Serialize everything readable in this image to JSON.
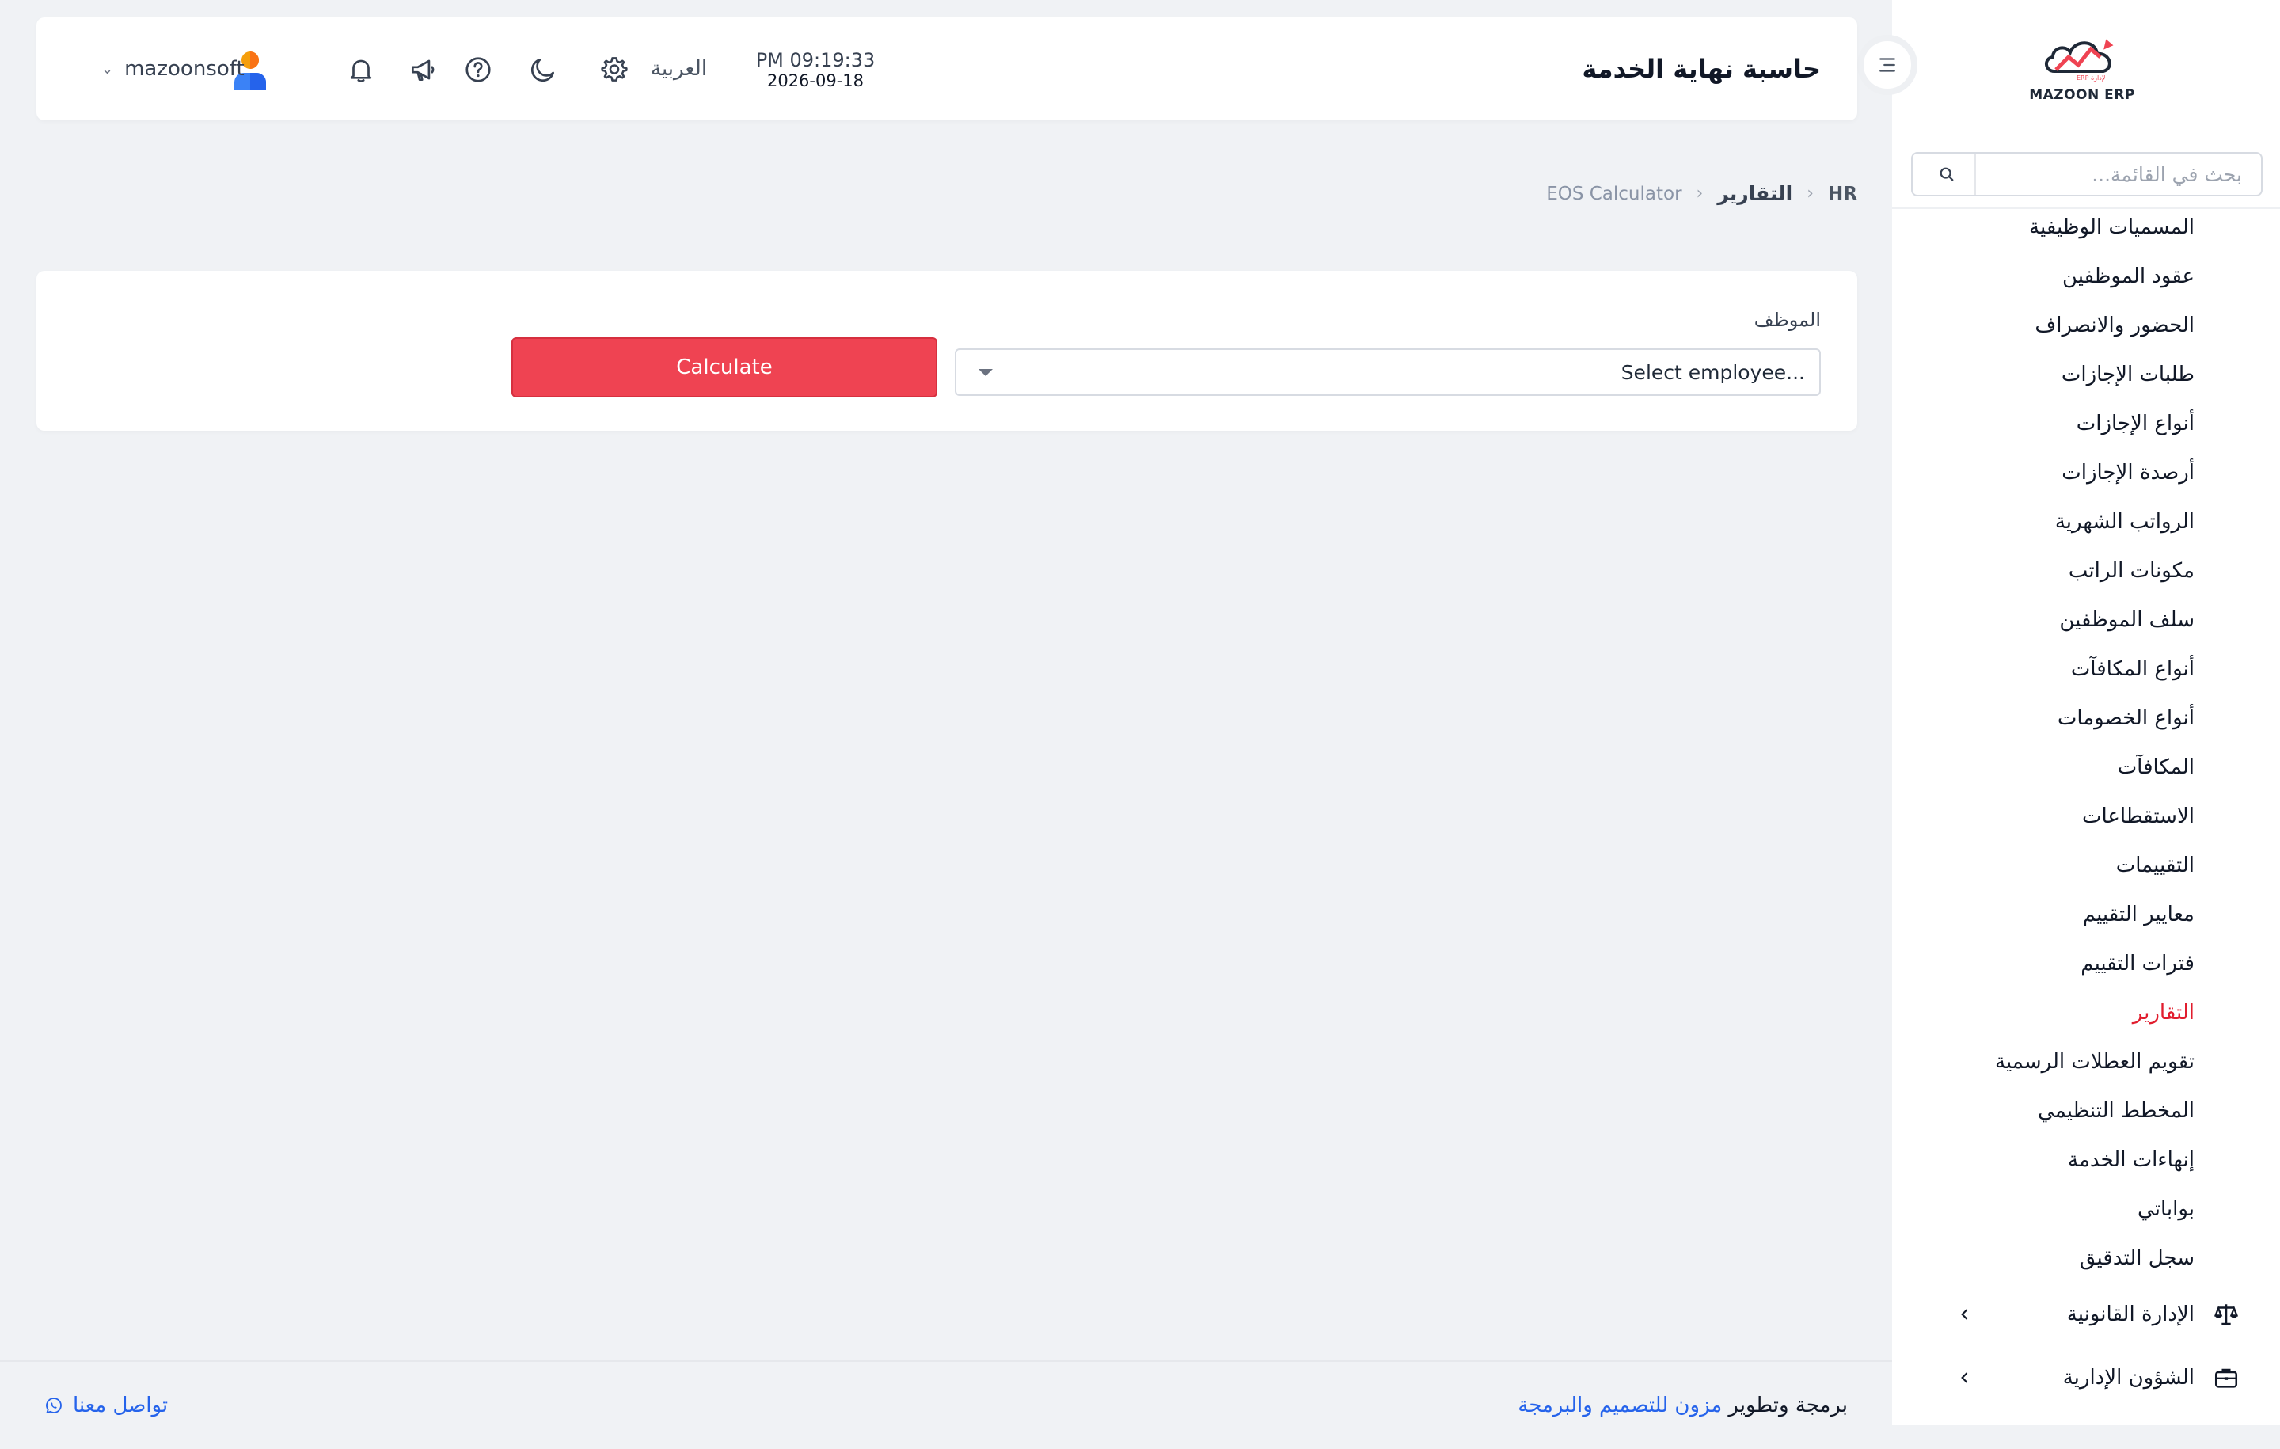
{
  "app": {
    "brand_name": "MAZOON ERP",
    "brand_small": "ERP لإدارة",
    "colors": {
      "accent": "#ef4352",
      "link": "#2563eb",
      "active_menu": "#e11d2e"
    }
  },
  "sidebar": {
    "search_placeholder": "بحث في القائمة...",
    "items": [
      {
        "label": "المسميات الوظيفية"
      },
      {
        "label": "عقود الموظفين"
      },
      {
        "label": "الحضور والانصراف"
      },
      {
        "label": "طلبات الإجازات"
      },
      {
        "label": "أنواع الإجازات"
      },
      {
        "label": "أرصدة الإجازات"
      },
      {
        "label": "الرواتب الشهرية"
      },
      {
        "label": "مكونات الراتب"
      },
      {
        "label": "سلف الموظفين"
      },
      {
        "label": "أنواع المكافآت"
      },
      {
        "label": "أنواع الخصومات"
      },
      {
        "label": "المكافآت"
      },
      {
        "label": "الاستقطاعات"
      },
      {
        "label": "التقييمات"
      },
      {
        "label": "معايير التقييم"
      },
      {
        "label": "فترات التقييم"
      },
      {
        "label": "التقارير",
        "active": true
      },
      {
        "label": "تقويم العطلات الرسمية"
      },
      {
        "label": "المخطط التنظيمي"
      },
      {
        "label": "إنهاءات الخدمة"
      },
      {
        "label": "بواباتي"
      },
      {
        "label": "سجل التدقيق"
      }
    ],
    "groups": [
      {
        "label": "الإدارة القانونية",
        "icon": "scale-icon"
      },
      {
        "label": "الشؤون الإدارية",
        "icon": "briefcase-icon"
      }
    ]
  },
  "header": {
    "title": "حاسبة نهاية الخدمة",
    "time": "PM 09:19:33",
    "date": "2026-09-18",
    "language": "العربية",
    "username": "mazoonsoft"
  },
  "breadcrumb": {
    "home": "HR",
    "parent": "التقارير",
    "current": "EOS Calculator"
  },
  "form": {
    "employee_label": "الموظف",
    "employee_placeholder": "Select employee...",
    "calculate_label": "Calculate"
  },
  "footer": {
    "credit_prefix": "برمجة وتطوير",
    "credit_company": "مزون للتصميم والبرمجة",
    "contact": "تواصل معنا"
  }
}
